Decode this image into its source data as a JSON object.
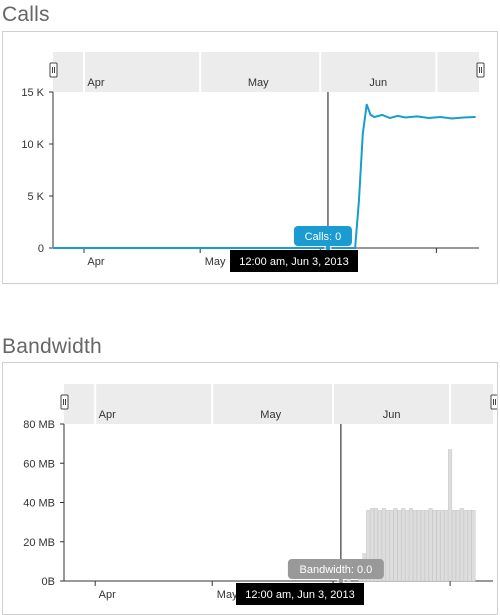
{
  "sections": {
    "calls": {
      "title": "Calls"
    },
    "bandwidth": {
      "title": "Bandwidth"
    }
  },
  "chart_data": [
    {
      "type": "line",
      "title": "Calls",
      "series": [
        {
          "name": "Calls",
          "color": "#1a9bd1",
          "x": [
            "2013-03-24",
            "2013-04-10",
            "2013-05-01",
            "2013-05-20",
            "2013-06-01",
            "2013-06-03",
            "2013-06-07",
            "2013-06-09",
            "2013-06-10",
            "2013-06-11",
            "2013-06-12",
            "2013-06-13",
            "2013-06-14",
            "2013-06-15",
            "2013-06-17",
            "2013-06-19",
            "2013-06-21",
            "2013-06-23",
            "2013-06-26",
            "2013-06-29",
            "2013-07-02",
            "2013-07-05",
            "2013-07-08",
            "2013-07-11"
          ],
          "values": [
            0,
            0,
            0,
            0,
            0,
            0,
            0,
            0,
            0,
            4500,
            11000,
            13800,
            12800,
            12600,
            12800,
            12500,
            12700,
            12550,
            12650,
            12500,
            12600,
            12450,
            12550,
            12600
          ]
        }
      ],
      "ylim": [
        0,
        15000
      ],
      "y_ticks": [
        "0",
        "5 K",
        "10 K",
        "15 K"
      ],
      "x_ticks": [
        "Apr",
        "May",
        "Jun"
      ],
      "navigator_labels": [
        "Apr",
        "May",
        "Jun"
      ],
      "grid": false,
      "tooltip": {
        "label": "Calls: 0",
        "date": "12:00 am, Jun 3, 2013",
        "color": "#1a9bd1"
      },
      "crosshair_date": "2013-06-03"
    },
    {
      "type": "bar",
      "title": "Bandwidth",
      "series": [
        {
          "name": "Bandwidth",
          "color": "#dddddd",
          "x": [
            "2013-06-05",
            "2013-06-08",
            "2013-06-09",
            "2013-06-10",
            "2013-06-11",
            "2013-06-12",
            "2013-06-13",
            "2013-06-14",
            "2013-06-15",
            "2013-06-16",
            "2013-06-17",
            "2013-06-18",
            "2013-06-19",
            "2013-06-20",
            "2013-06-21",
            "2013-06-22",
            "2013-06-23",
            "2013-06-24",
            "2013-06-25",
            "2013-06-26",
            "2013-06-27",
            "2013-06-28",
            "2013-06-29",
            "2013-06-30",
            "2013-07-01",
            "2013-07-02",
            "2013-07-03",
            "2013-07-04",
            "2013-07-05",
            "2013-07-06",
            "2013-07-07"
          ],
          "values": [
            3,
            1,
            14,
            36,
            37,
            37,
            36,
            37,
            36,
            36,
            37,
            36,
            37,
            36,
            37,
            36,
            36,
            36,
            36,
            37,
            36,
            36,
            36,
            36,
            67,
            36,
            36,
            37,
            36,
            36,
            36
          ]
        }
      ],
      "ylim": [
        0,
        80
      ],
      "y_ticks": [
        "0B",
        "20 MB",
        "40 MB",
        "60 MB",
        "80 MB"
      ],
      "x_ticks": [
        "Apr",
        "May",
        "Jun"
      ],
      "navigator_labels": [
        "Apr",
        "May",
        "Jun"
      ],
      "grid": false,
      "tooltip": {
        "label": "Bandwidth: 0.0",
        "date": "12:00 am, Jun 3, 2013",
        "color": "#999999"
      },
      "crosshair_date": "2013-06-03"
    }
  ]
}
